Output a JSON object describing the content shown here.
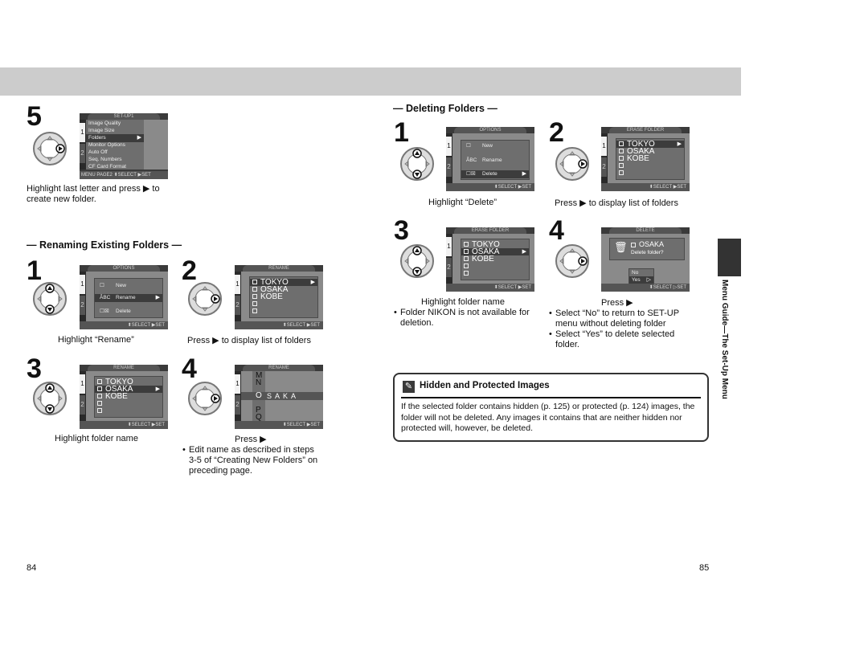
{
  "pages": {
    "left": "84",
    "right": "85"
  },
  "side_tab": {
    "label": "Menu Guide—The Set-Up Menu"
  },
  "glyphs": {
    "play": "▶",
    "updown": "⬍",
    "bullet": "•",
    "arrow_open": "▷"
  },
  "top_step": {
    "number": "5",
    "lcd": {
      "title": "SET-UP1",
      "tab1": "1",
      "tab2": "2",
      "items": [
        "Image Quality",
        "Image Size",
        "Folders",
        "Monitor Options",
        "Auto Off",
        "Seq. Numbers",
        "CF Card Format"
      ],
      "highlighted": "Folders",
      "footer": "MENU PAGE2  ⬍SELECT  ▶SET"
    },
    "caption": "Highlight last letter and press ▶ to create new folder."
  },
  "renaming": {
    "heading": "— Renaming Existing Folders —",
    "steps": [
      {
        "number": "1",
        "lcd_title": "OPTIONS",
        "items": [
          "New",
          "Rename",
          "Delete"
        ],
        "icons": [
          "☐",
          "ÂBC",
          "☐☒"
        ],
        "highlighted": "Rename",
        "caption": "Highlight “Rename”",
        "footer": "⬍SELECT  ▶SET"
      },
      {
        "number": "2",
        "lcd_title": "RENAME",
        "items": [
          "TOKYO",
          "OSAKA",
          "KOBE",
          "",
          ""
        ],
        "highlighted": "TOKYO",
        "caption": "Press ▶ to display list of folders",
        "footer": "⬍SELECT  ▶SET"
      },
      {
        "number": "3",
        "lcd_title": "RENAME",
        "items": [
          "TOKYO",
          "OSAKA",
          "KOBE",
          "",
          ""
        ],
        "highlighted": "OSAKA",
        "caption": "Highlight folder name",
        "footer": "⬍SELECT  ▶SET"
      },
      {
        "number": "4",
        "lcd_title": "RENAME",
        "letters_above": [
          "M",
          "N"
        ],
        "current_letter": "O",
        "name_rest": "S A K A",
        "letters_below": [
          "P",
          "Q"
        ],
        "caption": "Press ▶",
        "bullets": [
          "Edit name as described in steps 3-5 of “Creating New Folders” on preceding page."
        ],
        "footer": "⬍SELECT  ▶SET"
      }
    ]
  },
  "deleting": {
    "heading": "— Deleting Folders —",
    "steps": [
      {
        "number": "1",
        "lcd_title": "OPTIONS",
        "items": [
          "New",
          "Rename",
          "Delete"
        ],
        "icons": [
          "☐",
          "ÂBC",
          "☐☒"
        ],
        "highlighted": "Delete",
        "caption": "Highlight “Delete”",
        "footer": "⬍SELECT  ▶SET"
      },
      {
        "number": "2",
        "lcd_title": "ERASE FOLDER",
        "items": [
          "TOKYO",
          "OSAKA",
          "KOBE",
          "",
          ""
        ],
        "highlighted": "TOKYO",
        "caption": "Press ▶ to display list of folders",
        "footer": "⬍SELECT  ▶SET"
      },
      {
        "number": "3",
        "lcd_title": "ERASE FOLDER",
        "items": [
          "TOKYO",
          "OSAKA",
          "KOBE",
          "",
          ""
        ],
        "highlighted": "OSAKA",
        "caption": "Highlight folder name",
        "bullets": [
          "Folder NIKON is not available for deletion."
        ],
        "footer": "⬍SELECT  ▶SET"
      },
      {
        "number": "4",
        "lcd_title": "DELETE",
        "folder": "OSAKA",
        "prompt": "Delete folder?",
        "options": [
          "No",
          "Yes"
        ],
        "highlighted": "Yes",
        "caption": "Press ▶",
        "bullets": [
          "Select “No” to return to SET-UP menu without deleting folder",
          "Select “Yes” to delete selected folder."
        ],
        "footer": "⬍SELECT  ▷SET"
      }
    ]
  },
  "note": {
    "icon": "pencil-icon",
    "title": "Hidden and Protected Images",
    "body": "If the selected folder contains hidden (p. 125) or protected (p. 124) images, the folder will not be deleted. Any images it contains that are neither hidden nor protected will, however, be deleted."
  }
}
